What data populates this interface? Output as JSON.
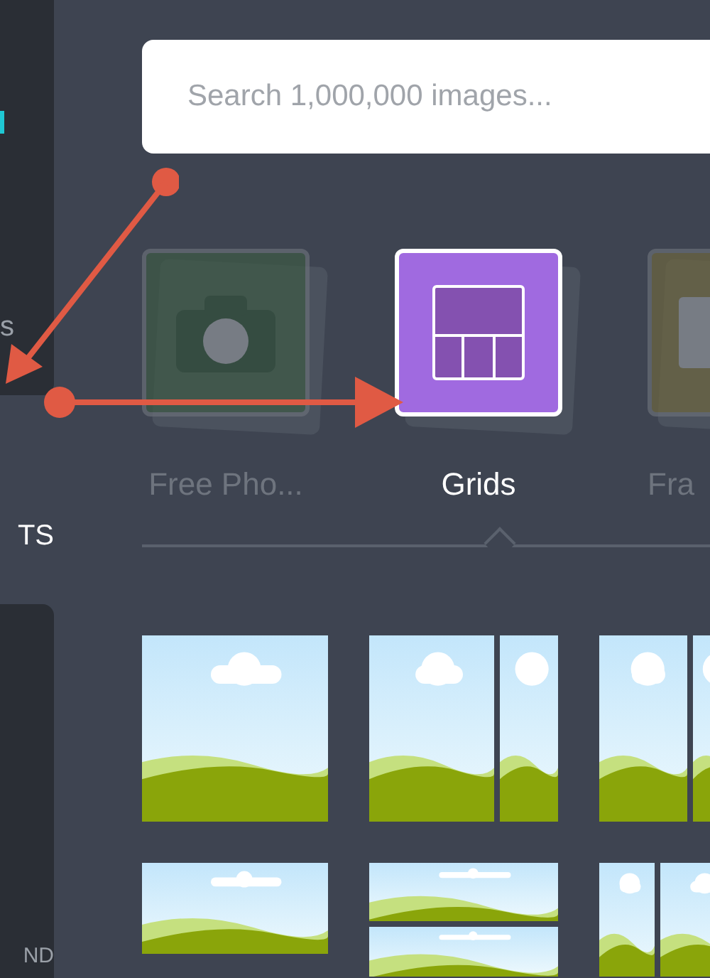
{
  "sidebar": {
    "top_label": "s",
    "middle_label": "TS",
    "bottom_label": "ND"
  },
  "search": {
    "placeholder": "Search 1,000,000 images..."
  },
  "categories": [
    {
      "label": "Free Pho...",
      "selected": false,
      "kind": "camera"
    },
    {
      "label": "Grids",
      "selected": true,
      "kind": "grid"
    },
    {
      "label": "Fra",
      "selected": false,
      "kind": "frame"
    }
  ]
}
